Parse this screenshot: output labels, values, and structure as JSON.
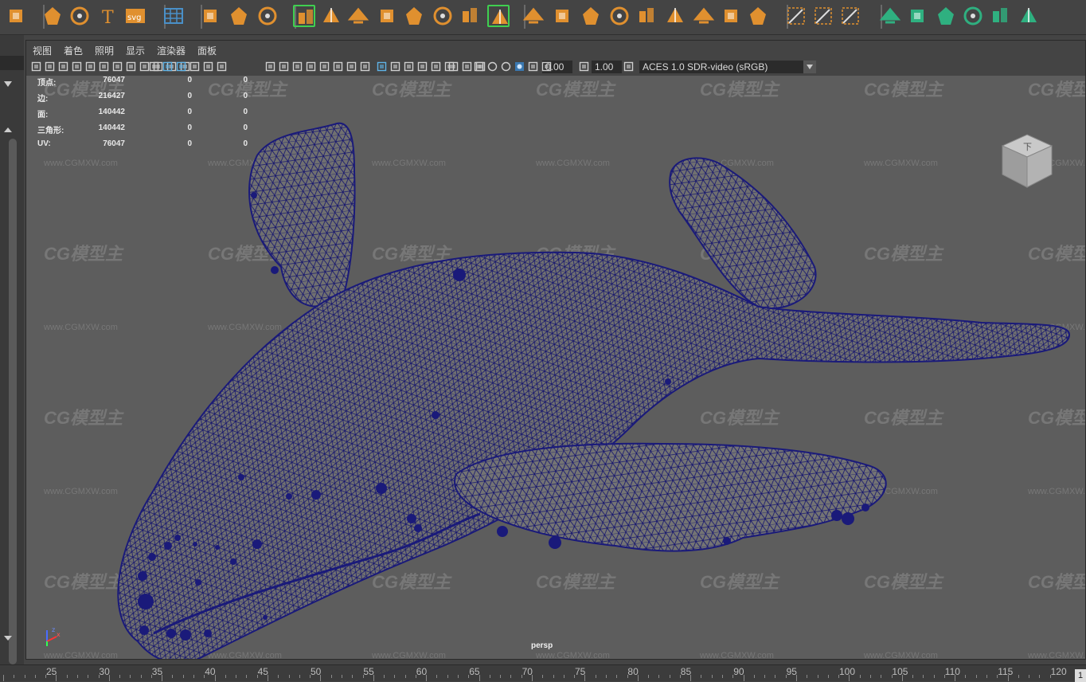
{
  "colors": {
    "accent": "#e0902f",
    "select_frame": "#3fcf50",
    "wire": "#1a1a7a",
    "viewport_bg": "#5d5d5d"
  },
  "shelf_icons": [
    "polygon-sphere-icon",
    "star-sweep-icon",
    "spiral-icon",
    "text-tool-icon",
    "svg-tool-icon",
    "grid-toggle-icon",
    "center-pivot-icon",
    "smooth-tool-icon",
    "particle-icon",
    "sculpt-brush-icon",
    "retopology-icon",
    "combine-icon",
    "extrude-icon",
    "bevel-icon",
    "append-polygon-icon",
    "mirror-icon",
    "bridge-icon",
    "soft-select-icon",
    "insert-edge-loop-icon",
    "multi-cut-icon",
    "quad-draw-icon",
    "target-weld-icon",
    "bevel-edge-icon",
    "slide-edge-icon",
    "crease-tool-icon",
    "connect-icon",
    "paint-select-icon",
    "uv-layout-icon",
    "uv-editor-icon",
    "planar-uv-icon",
    "cylindrical-uv-icon",
    "spherical-uv-icon",
    "automatic-uv-icon",
    "uv-unfold-icon",
    "uv-checker-icon"
  ],
  "panel_menu": [
    "视图",
    "着色",
    "照明",
    "显示",
    "渲染器",
    "面板"
  ],
  "viewport_toolbar": {
    "exposure": "0.00",
    "gamma": "1.00",
    "color_space": "ACES 1.0 SDR-video (sRGB)"
  },
  "hud_stats": [
    {
      "label": "顶点:",
      "values": [
        "76047",
        "0",
        "0"
      ]
    },
    {
      "label": "边:",
      "values": [
        "216427",
        "0",
        "0"
      ]
    },
    {
      "label": "面:",
      "values": [
        "140442",
        "0",
        "0"
      ]
    },
    {
      "label": "三角形:",
      "values": [
        "140442",
        "0",
        "0"
      ]
    },
    {
      "label": "UV:",
      "values": [
        "76047",
        "0",
        "0"
      ]
    }
  ],
  "viewcube_label": "下",
  "camera_label": "persp",
  "watermark_logo": "CG模型主",
  "watermark_url": "www.CGMXW.com",
  "axis_labels": {
    "z": "z",
    "x": "x"
  },
  "timeline": {
    "labels": [
      "25",
      "30",
      "35",
      "40",
      "45",
      "50",
      "55",
      "60",
      "65",
      "70",
      "75",
      "80",
      "85",
      "90",
      "95",
      "100",
      "105",
      "110",
      "115",
      "120"
    ],
    "current": "1"
  }
}
